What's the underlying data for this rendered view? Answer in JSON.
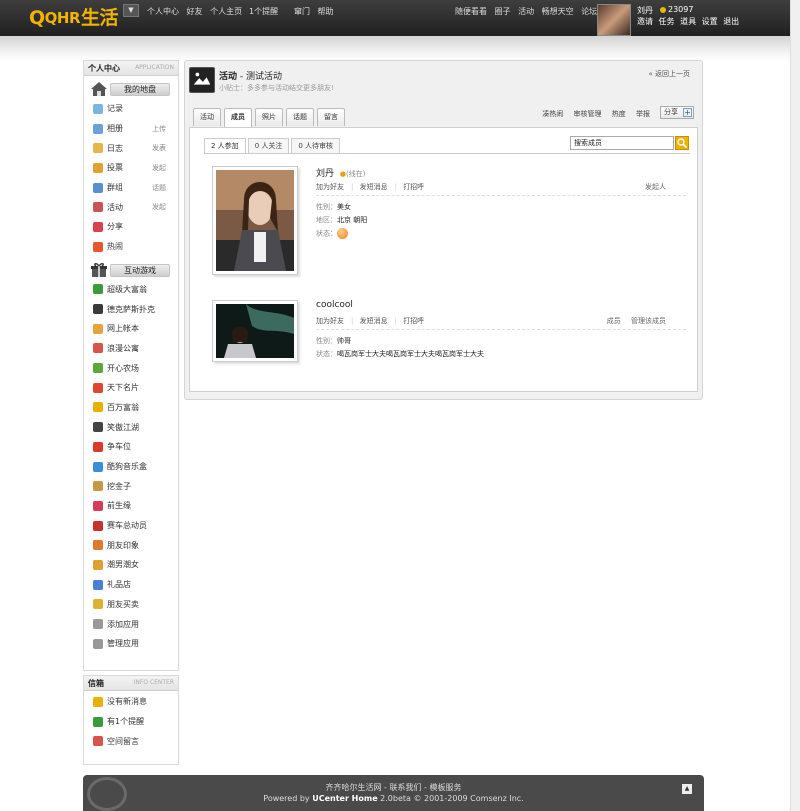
{
  "logo": {
    "q": "Q",
    "qhr": "QHR",
    "life": "生活"
  },
  "topnav_left": [
    "个人中心",
    "好友",
    "个人主页"
  ],
  "topnav_remind": "1个提醒",
  "topnav_mid": [
    "窜门",
    "帮助"
  ],
  "topnav_right": [
    "随便看看",
    "圈子",
    "活动",
    "畅想天空",
    "论坛"
  ],
  "user": {
    "name": "刘丹",
    "points": "23097",
    "links": [
      "邀请",
      "任务",
      "道具",
      "设置",
      "退出"
    ]
  },
  "sidebar": {
    "title": "个人中心",
    "title_en": "APPLICATION",
    "my_section": "我的地盘",
    "my_items": [
      {
        "label": "记录",
        "extra": "",
        "icon": "record-icon",
        "color": "#7ab5e0"
      },
      {
        "label": "相册",
        "extra": "上传",
        "icon": "album-icon",
        "color": "#6aa2d8"
      },
      {
        "label": "日志",
        "extra": "发表",
        "icon": "blog-icon",
        "color": "#e8b54a"
      },
      {
        "label": "投票",
        "extra": "发起",
        "icon": "poll-icon",
        "color": "#e2a233"
      },
      {
        "label": "群组",
        "extra": "话题",
        "icon": "group-icon",
        "color": "#5a8fd1"
      },
      {
        "label": "活动",
        "extra": "发起",
        "icon": "event-icon",
        "color": "#c95555"
      },
      {
        "label": "分享",
        "extra": "",
        "icon": "share-icon",
        "color": "#d9424b"
      },
      {
        "label": "热闹",
        "extra": "",
        "icon": "hot-icon",
        "color": "#e8582c"
      }
    ],
    "game_section": "互动游戏",
    "game_items": [
      {
        "label": "超级大富翁",
        "icon": "monopoly-icon",
        "color": "#3b9b3b"
      },
      {
        "label": "德克萨斯扑克",
        "icon": "poker-icon",
        "color": "#3a3a3a"
      },
      {
        "label": "网上帐本",
        "icon": "ledger-icon",
        "color": "#e6a43a"
      },
      {
        "label": "浪漫公寓",
        "icon": "apartment-icon",
        "color": "#d9524e"
      },
      {
        "label": "开心农场",
        "icon": "farm-icon",
        "color": "#59a83a"
      },
      {
        "label": "天下名片",
        "icon": "card-icon",
        "color": "#e0452e"
      },
      {
        "label": "百万富翁",
        "icon": "millionaire-icon",
        "color": "#e8b000"
      },
      {
        "label": "笑傲江湖",
        "icon": "kungfu-icon",
        "color": "#444444"
      },
      {
        "label": "争车位",
        "icon": "parking-icon",
        "color": "#d93a2a"
      },
      {
        "label": "酷狗音乐盒",
        "icon": "music-icon",
        "color": "#3a8fd9"
      },
      {
        "label": "挖金子",
        "icon": "gold-icon",
        "color": "#c79a40"
      },
      {
        "label": "前生缘",
        "icon": "fate-icon",
        "color": "#d93a5a"
      },
      {
        "label": "赛车总动员",
        "icon": "racing-icon",
        "color": "#c9302c"
      },
      {
        "label": "朋友印象",
        "icon": "impression-icon",
        "color": "#e07a2a"
      },
      {
        "label": "潮男潮女",
        "icon": "fashion-icon",
        "color": "#e0a030"
      },
      {
        "label": "礼品店",
        "icon": "gift-icon",
        "color": "#4a7fd1"
      },
      {
        "label": "朋友买卖",
        "icon": "trade-icon",
        "color": "#e0b030"
      },
      {
        "label": "添加应用",
        "icon": "add-app-icon",
        "color": "#999999"
      },
      {
        "label": "管理应用",
        "icon": "manage-app-icon",
        "color": "#999999"
      }
    ]
  },
  "info_center": {
    "title": "信箱",
    "title_en": "INFO CENTER",
    "items": [
      {
        "label": "没有新消息",
        "icon": "mail-icon",
        "color": "#e8b000"
      },
      {
        "label": "有1个提醒",
        "icon": "notice-icon",
        "color": "#3a9b3a"
      },
      {
        "label": "空间留言",
        "icon": "comment-icon",
        "color": "#d9524e"
      }
    ]
  },
  "activity": {
    "section": "活动",
    "name": "测试活动",
    "sub": "小贴士：多多参与活动结交更多朋友!",
    "back": "« 返回上一页",
    "tabs": [
      "活动",
      "成员",
      "照片",
      "话题",
      "留言"
    ],
    "active_tab": 1,
    "right_links": [
      "凑热闹",
      "审核管理",
      "热度",
      "举报"
    ],
    "share": "分享",
    "share_plus": "+"
  },
  "members_panel": {
    "subtabs": [
      "2 人参加",
      "0 人关注",
      "0 人待审核"
    ],
    "search_value": "搜索成员",
    "members": [
      {
        "name": "刘丹",
        "online": "(线在)",
        "actions": [
          "加为好友",
          "发短消息",
          "打招呼"
        ],
        "role": [
          "发起人"
        ],
        "fields": [
          {
            "label": "性别：",
            "value": "美女"
          },
          {
            "label": "地区：",
            "value": "北京  朝阳"
          },
          {
            "label": "状态：",
            "value": ""
          }
        ]
      },
      {
        "name": "coolcool",
        "online": "",
        "actions": [
          "加为好友",
          "发短消息",
          "打招呼"
        ],
        "role": [
          "成员",
          "管理该成员"
        ],
        "fields": [
          {
            "label": "性别：",
            "value": "帅哥"
          },
          {
            "label": "状态：",
            "value": "喝瓦岗军士大夫喝瓦岗军士大夫喝瓦岗军士大夫"
          }
        ]
      }
    ]
  },
  "footer": {
    "links": "齐齐哈尔生活网 - 联系我们 - 模板服务",
    "powered_prefix": "Powered by ",
    "powered_name": "UCenter Home",
    "powered_suffix": " 2.0beta © 2001-2009 Comsenz Inc.",
    "totop": "▲"
  }
}
